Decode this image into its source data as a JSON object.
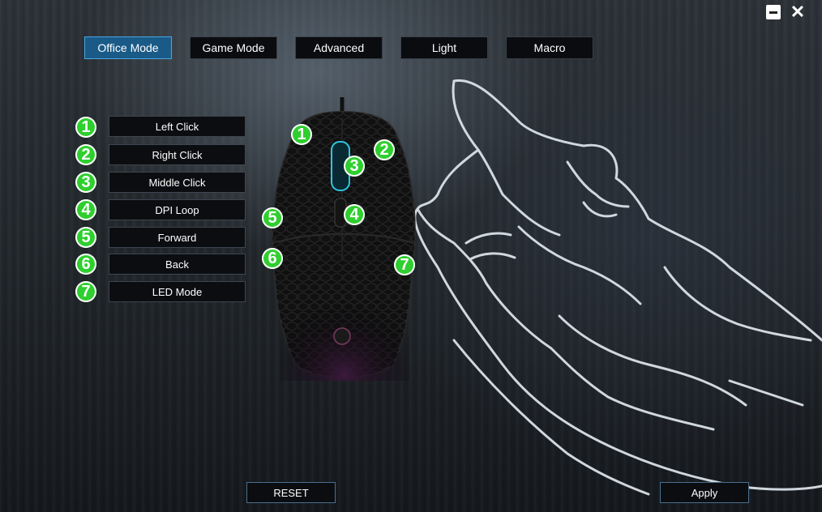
{
  "window": {
    "minimize_icon": "minimize-icon",
    "close_icon": "close-icon"
  },
  "tabs": [
    {
      "label": "Office Mode",
      "active": true
    },
    {
      "label": "Game Mode",
      "active": false
    },
    {
      "label": "Advanced",
      "active": false
    },
    {
      "label": "Light",
      "active": false
    },
    {
      "label": "Macro",
      "active": false
    }
  ],
  "buttons": [
    {
      "number": "1",
      "label": "Left Click"
    },
    {
      "number": "2",
      "label": "Right Click"
    },
    {
      "number": "3",
      "label": "Middle Click"
    },
    {
      "number": "4",
      "label": "DPI Loop"
    },
    {
      "number": "5",
      "label": "Forward"
    },
    {
      "number": "6",
      "label": "Back"
    },
    {
      "number": "7",
      "label": "LED Mode"
    }
  ],
  "mouse_markers": [
    "1",
    "2",
    "3",
    "4",
    "5",
    "6",
    "7"
  ],
  "footer": {
    "reset_label": "RESET",
    "apply_label": "Apply"
  },
  "colors": {
    "accent": "#1a5a87",
    "marker": "#2ecf2e"
  }
}
